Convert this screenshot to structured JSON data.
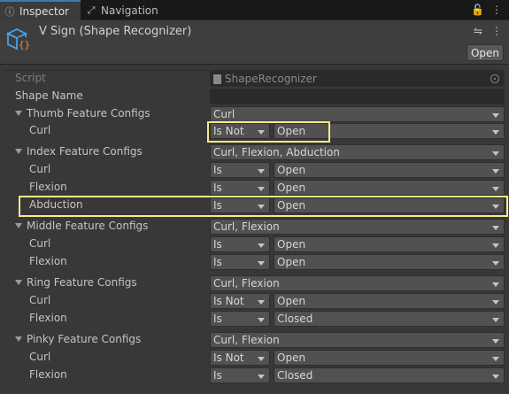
{
  "tabs": {
    "inspector": {
      "label": "Inspector",
      "icon": "info-icon"
    },
    "navigation": {
      "label": "Navigation",
      "icon": "navigation-icon"
    }
  },
  "header": {
    "title": "V Sign (Shape Recognizer)",
    "open_label": "Open",
    "icon": "scriptable-object-icon"
  },
  "fields": {
    "script": {
      "label": "Script",
      "value": "ShapeRecognizer"
    },
    "shape_name": {
      "label": "Shape Name",
      "value": ""
    }
  },
  "groups": [
    {
      "label": "Thumb Feature Configs",
      "value": "Curl",
      "items": [
        {
          "label": "Curl",
          "mode": "Is Not",
          "state": "Open"
        }
      ]
    },
    {
      "label": "Index Feature Configs",
      "value": "Curl, Flexion, Abduction",
      "items": [
        {
          "label": "Curl",
          "mode": "Is",
          "state": "Open"
        },
        {
          "label": "Flexion",
          "mode": "Is",
          "state": "Open"
        },
        {
          "label": "Abduction",
          "mode": "Is",
          "state": "Open"
        }
      ]
    },
    {
      "label": "Middle Feature Configs",
      "value": "Curl, Flexion",
      "items": [
        {
          "label": "Curl",
          "mode": "Is",
          "state": "Open"
        },
        {
          "label": "Flexion",
          "mode": "Is",
          "state": "Open"
        }
      ]
    },
    {
      "label": "Ring Feature Configs",
      "value": "Curl, Flexion",
      "items": [
        {
          "label": "Curl",
          "mode": "Is Not",
          "state": "Open"
        },
        {
          "label": "Flexion",
          "mode": "Is",
          "state": "Closed"
        }
      ]
    },
    {
      "label": "Pinky Feature Configs",
      "value": "Curl, Flexion",
      "items": [
        {
          "label": "Curl",
          "mode": "Is Not",
          "state": "Open"
        },
        {
          "label": "Flexion",
          "mode": "Is",
          "state": "Closed"
        }
      ]
    }
  ],
  "colors": {
    "highlight": "#f6ec84",
    "accent": "#3a79bb",
    "icon_orange": "#f08a3c",
    "icon_blue": "#4aa3e8"
  }
}
